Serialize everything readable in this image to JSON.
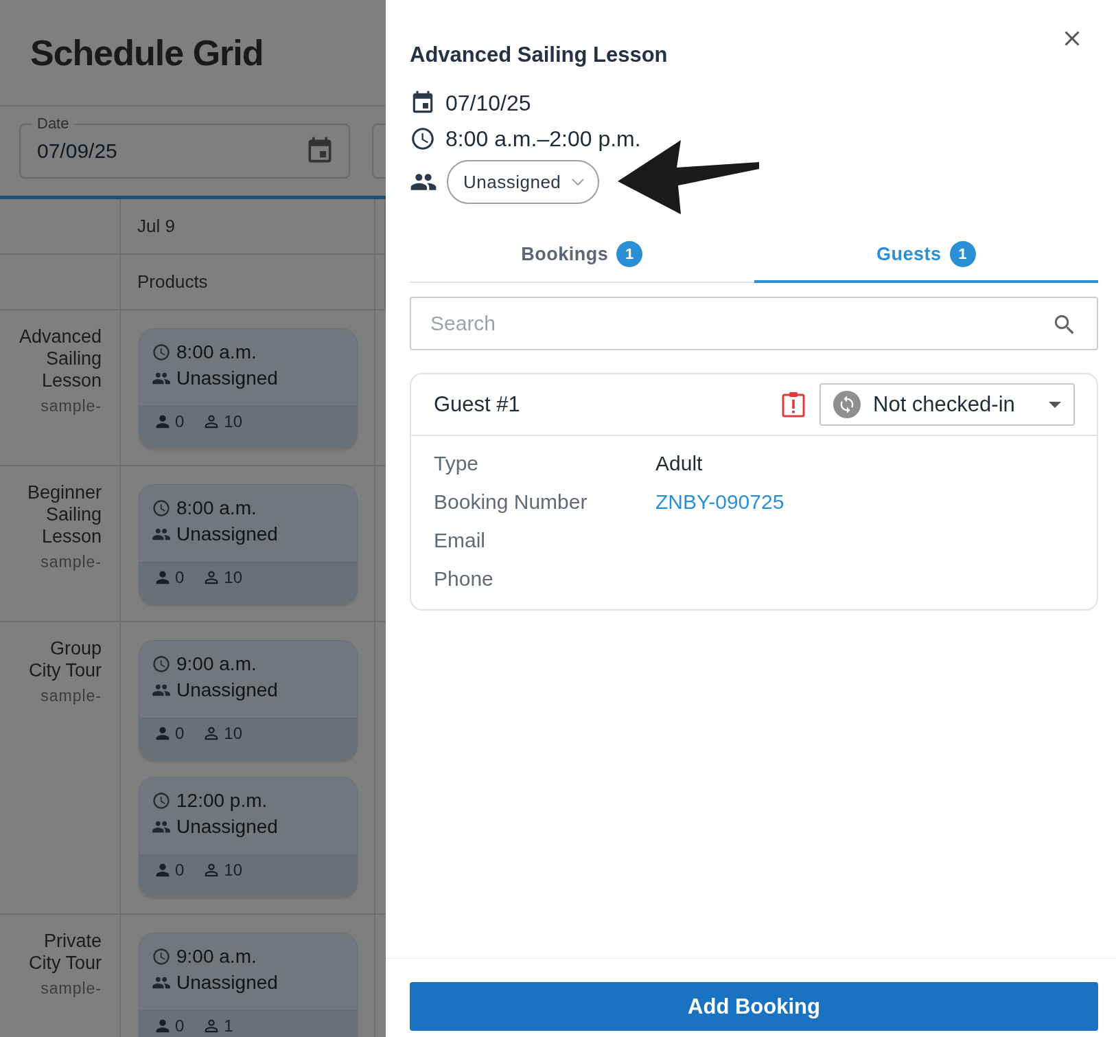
{
  "page_title": "Schedule Grid",
  "date_filter": {
    "label": "Date",
    "value": "07/09/25"
  },
  "grid": {
    "day_header": "Jul 9",
    "column_header": "Products",
    "rows": [
      {
        "product": "Advanced Sailing Lesson",
        "code": "sample-",
        "slots": [
          {
            "time": "8:00 a.m.",
            "staff": "Unassigned",
            "booked": "0",
            "capacity": "10"
          }
        ]
      },
      {
        "product": "Beginner Sailing Lesson",
        "code": "sample-",
        "slots": [
          {
            "time": "8:00 a.m.",
            "staff": "Unassigned",
            "booked": "0",
            "capacity": "10"
          }
        ]
      },
      {
        "product": "Group City Tour",
        "code": "sample-",
        "slots": [
          {
            "time": "9:00 a.m.",
            "staff": "Unassigned",
            "booked": "0",
            "capacity": "10"
          },
          {
            "time": "12:00 p.m.",
            "staff": "Unassigned",
            "booked": "0",
            "capacity": "10"
          }
        ]
      },
      {
        "product": "Private City Tour",
        "code": "sample-",
        "slots": [
          {
            "time": "9:00 a.m.",
            "staff": "Unassigned",
            "booked": "0",
            "capacity": "1"
          }
        ]
      }
    ]
  },
  "drawer": {
    "title": "Advanced Sailing Lesson",
    "date": "07/10/25",
    "time": "8:00 a.m.–2:00 p.m.",
    "staff_select": "Unassigned",
    "tabs": [
      {
        "label": "Bookings",
        "count": "1",
        "selected": false
      },
      {
        "label": "Guests",
        "count": "1",
        "selected": true
      }
    ],
    "search": {
      "placeholder": "Search"
    },
    "guests": [
      {
        "title": "Guest #1",
        "status": "Not checked-in",
        "fields": [
          {
            "label": "Type",
            "value": "Adult",
            "kind": "text"
          },
          {
            "label": "Booking Number",
            "value": "ZNBY-090725",
            "kind": "link"
          },
          {
            "label": "Email",
            "kind": "text"
          },
          {
            "label": "Phone",
            "kind": "text"
          }
        ]
      }
    ],
    "primary_button": "Add Booking"
  }
}
